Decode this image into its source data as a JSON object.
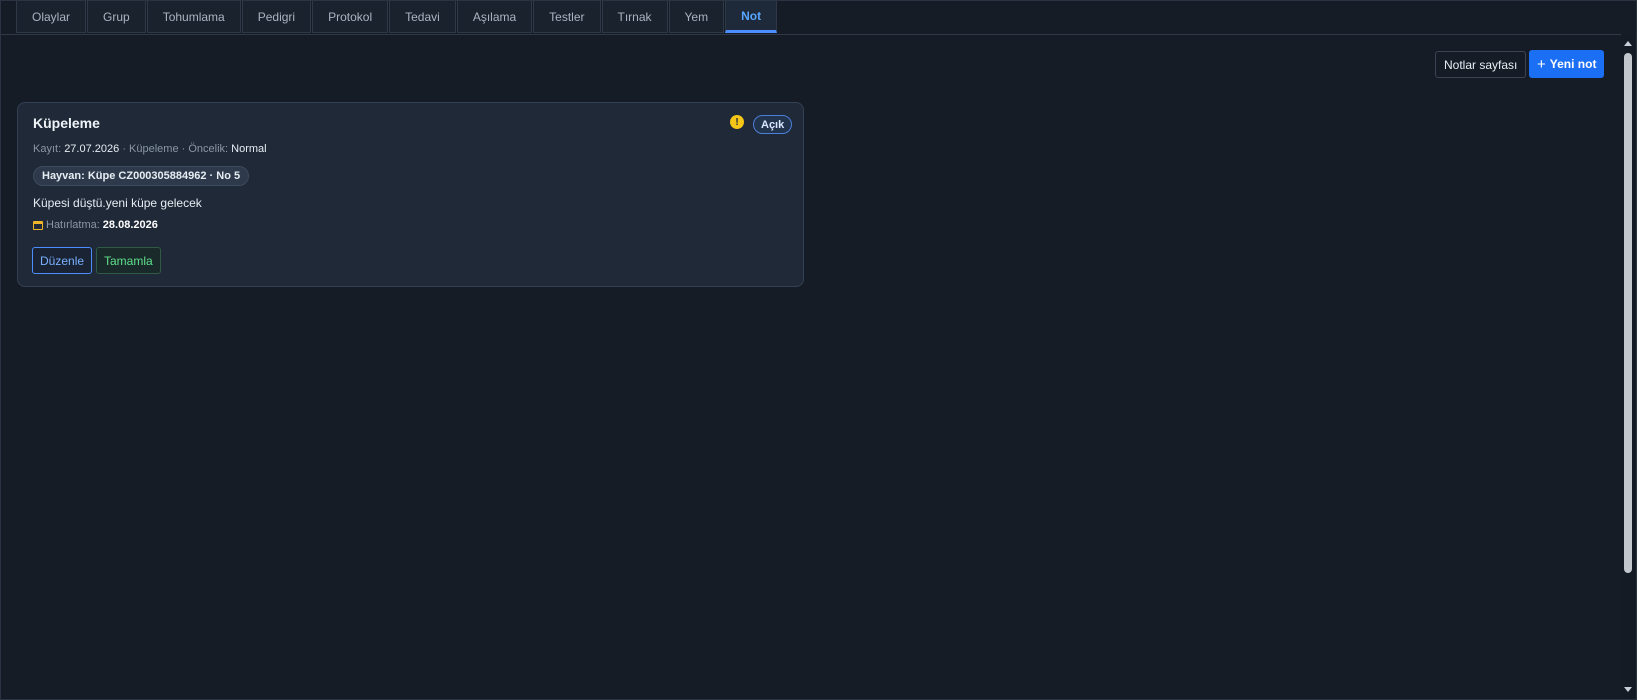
{
  "tabs": [
    {
      "label": "Olaylar"
    },
    {
      "label": "Grup"
    },
    {
      "label": "Tohumlama"
    },
    {
      "label": "Pedigri"
    },
    {
      "label": "Protokol"
    },
    {
      "label": "Tedavi"
    },
    {
      "label": "Aşılama"
    },
    {
      "label": "Testler"
    },
    {
      "label": "Tırnak"
    },
    {
      "label": "Yem"
    },
    {
      "label": "Not"
    }
  ],
  "active_tab": "Not",
  "toolbar": {
    "notes_page_label": "Notlar sayfası",
    "new_note_label": "Yeni not",
    "new_note_icon": "plus-icon"
  },
  "note": {
    "title": "Küpeleme",
    "status": "Açık",
    "warning_icon": "exclamation-icon",
    "meta_record_label": "Kayıt:",
    "meta_record_date": "27.07.2026",
    "meta_category": "· Küpeleme ·",
    "meta_priority_label": "Öncelik:",
    "meta_priority": "Normal",
    "animal": "Hayvan: Küpe CZ000305884962 · No 5",
    "text": "Küpesi düştü.yeni küpe gelecek",
    "reminder_icon": "calendar-icon",
    "reminder_label": "Hatırlatma:",
    "reminder_date": "28.08.2026",
    "edit_label": "Düzenle",
    "complete_label": "Tamamla"
  },
  "colors": {
    "background": "#141b25",
    "card": "#1f2937",
    "accent": "#1a6ff5",
    "warning": "#f5c518",
    "success": "#5ee08a"
  }
}
